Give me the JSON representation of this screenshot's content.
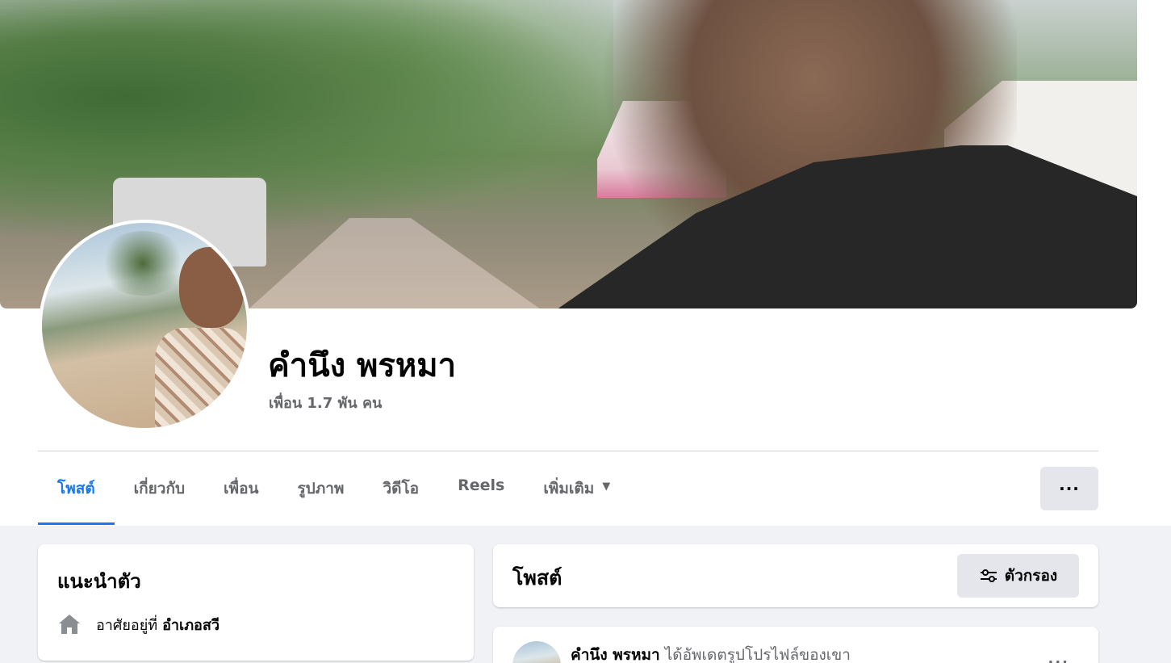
{
  "profile": {
    "name": "คำนึง พรหมา",
    "friends": "เพื่อน 1.7 พัน คน"
  },
  "tabs": [
    {
      "label": "โพสต์",
      "active": true
    },
    {
      "label": "เกี่ยวกับ",
      "active": false
    },
    {
      "label": "เพื่อน",
      "active": false
    },
    {
      "label": "รูปภาพ",
      "active": false
    },
    {
      "label": "วิดีโอ",
      "active": false
    },
    {
      "label": "Reels",
      "active": false
    },
    {
      "label": "เพิ่มเติม",
      "active": false,
      "icon": "caret-down-icon"
    }
  ],
  "more_button": {
    "label": "···",
    "icon": "more-icon"
  },
  "intro": {
    "title": "แนะนำตัว",
    "lives_in_prefix": "อาศัยอยู่ที่",
    "lives_in_value": "อำเภอสวี",
    "icon": "home-icon"
  },
  "posts": {
    "title": "โพสต์",
    "filter_label": "ตัวกรอง",
    "filter_icon": "filter-icon"
  },
  "post": {
    "author": "คำนึง พรหมา",
    "action": "ได้อัพเดตรูปโปรไฟล์ของเขา",
    "menu": "···"
  },
  "colors": {
    "accent": "#1877f2",
    "secondary_text": "#65676b",
    "background": "#f0f2f5",
    "button_gray": "#e4e6eb"
  }
}
